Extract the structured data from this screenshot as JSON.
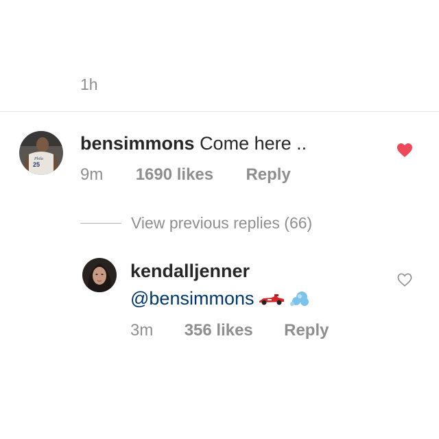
{
  "previous_comment": {
    "time": "1h"
  },
  "comment1": {
    "username": "bensimmons",
    "text": "Come here ..",
    "time": "9m",
    "likes": "1690 likes",
    "reply": "Reply",
    "liked": true,
    "heart_color": "#ed4956"
  },
  "view_previous": {
    "label": "View previous replies (66)"
  },
  "comment2": {
    "username": "kendalljenner",
    "mention": "@bensimmons",
    "emojis": [
      "racing-car-icon",
      "dash-cloud-icon"
    ],
    "time": "3m",
    "likes": "356 likes",
    "reply": "Reply",
    "liked": false
  },
  "colors": {
    "text": "#262626",
    "secondary": "#8e8e8e",
    "mention": "#00376b",
    "like_red": "#ed4956"
  }
}
